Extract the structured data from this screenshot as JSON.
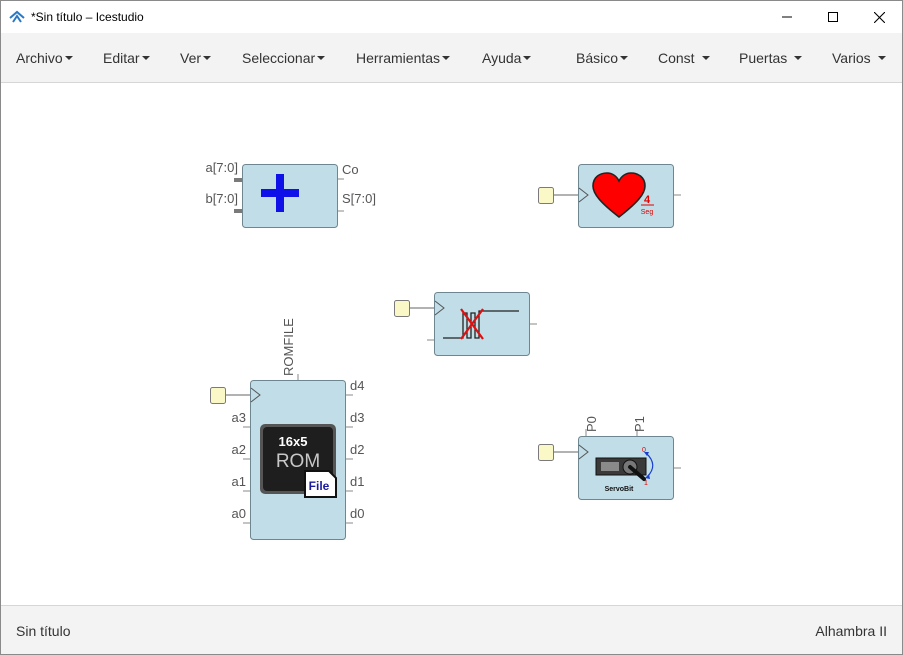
{
  "window": {
    "title": "*Sin título – Icestudio"
  },
  "menu": {
    "archivo": "Archivo",
    "editar": "Editar",
    "ver": "Ver",
    "seleccionar": "Seleccionar",
    "herramientas": "Herramientas",
    "ayuda": "Ayuda",
    "basico": "Básico",
    "const": "Const",
    "puertas": "Puertas",
    "varios": "Varios"
  },
  "blocks": {
    "adder": {
      "inputs": [
        "a[7:0]",
        "b[7:0]"
      ],
      "outputs": [
        "Co",
        "S[7:0]"
      ]
    },
    "heart": {
      "big": "4",
      "small": "Seg"
    },
    "rom": {
      "param": "ROMFILE",
      "chip_top": "16x5",
      "chip_main": "ROM",
      "file": "File",
      "inputs": [
        "a3",
        "a2",
        "a1",
        "a0"
      ],
      "outputs": [
        "d4",
        "d3",
        "d2",
        "d1",
        "d0"
      ]
    },
    "servo": {
      "params": [
        "P0",
        "P1"
      ],
      "caption": "ServoBit",
      "top_mark": "0",
      "bottom_mark": "1"
    }
  },
  "footer": {
    "left": "Sin título",
    "right": "Alhambra II"
  },
  "colors": {
    "block_fill": "#c1dde7",
    "block_stroke": "#6d8690",
    "port_fill": "#fbf8c8",
    "adder_plus": "#1010e8",
    "heart": "#ff0000"
  }
}
